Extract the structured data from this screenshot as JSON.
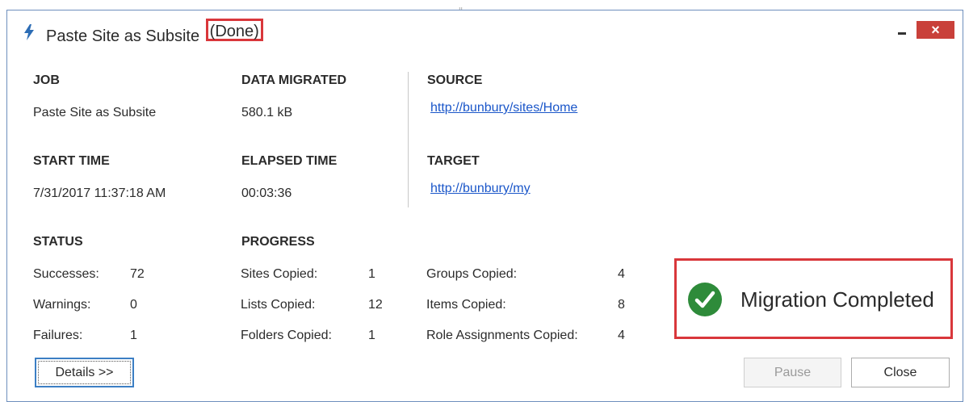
{
  "window": {
    "title_main": "Paste Site as Subsite",
    "title_status": "(Done)",
    "minimize_label": "",
    "close_label": "×"
  },
  "job": {
    "label": "JOB",
    "value": "Paste Site as Subsite"
  },
  "data_migrated": {
    "label": "DATA MIGRATED",
    "value": "580.1 kB"
  },
  "source": {
    "label": "SOURCE",
    "url": "http://bunbury/sites/Home"
  },
  "start_time": {
    "label": "START TIME",
    "value": "7/31/2017 11:37:18 AM"
  },
  "elapsed_time": {
    "label": "ELAPSED TIME",
    "value": "00:03:36"
  },
  "target": {
    "label": "TARGET",
    "url": "http://bunbury/my"
  },
  "status": {
    "label": "STATUS",
    "items": [
      {
        "label": "Successes:",
        "value": "72"
      },
      {
        "label": "Warnings:",
        "value": "0"
      },
      {
        "label": "Failures:",
        "value": "1"
      }
    ]
  },
  "progress": {
    "label": "PROGRESS",
    "col1": [
      {
        "label": "Sites Copied:",
        "value": "1"
      },
      {
        "label": "Lists Copied:",
        "value": "12"
      },
      {
        "label": "Folders Copied:",
        "value": "1"
      }
    ],
    "col2": [
      {
        "label": "Groups Copied:",
        "value": "4"
      },
      {
        "label": "Items Copied:",
        "value": "8"
      },
      {
        "label": "Role Assignments Copied:",
        "value": "4"
      }
    ]
  },
  "completion": {
    "text": "Migration Completed",
    "icon": "check-circle-icon",
    "color": "#2e8b3a"
  },
  "buttons": {
    "details": "Details >>",
    "pause": "Pause",
    "close": "Close"
  },
  "colors": {
    "accent_red": "#d9373b",
    "link_blue": "#1a56c9",
    "close_btn": "#c9403a"
  }
}
